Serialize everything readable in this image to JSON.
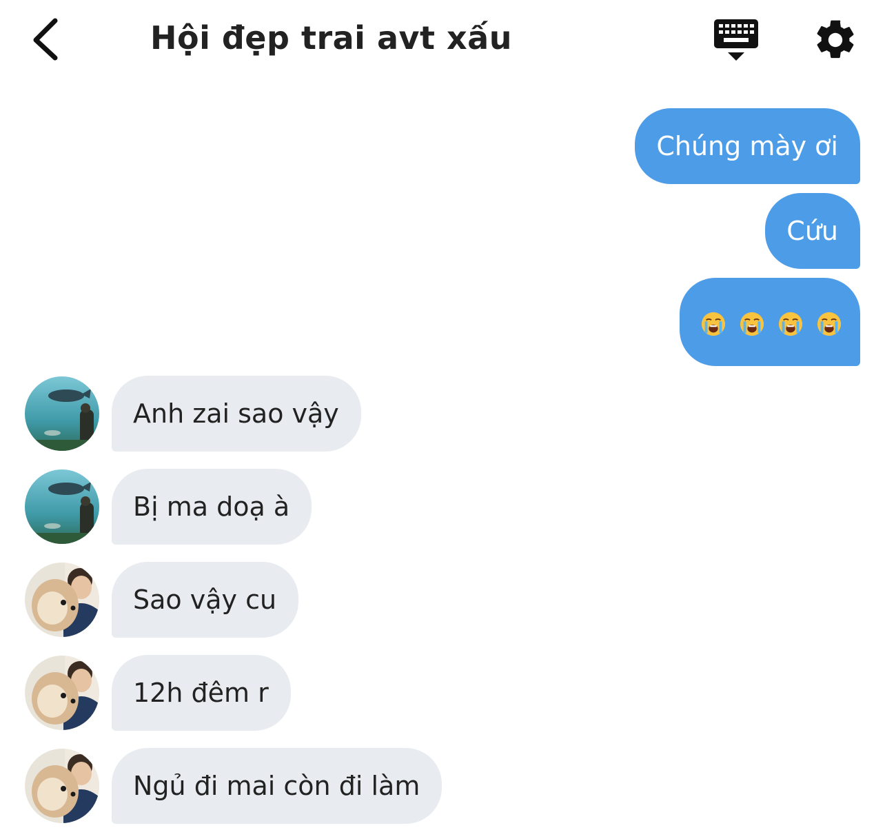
{
  "header": {
    "title": "Hội đẹp trai avt xấu",
    "back_icon": "chevron-left-icon",
    "keyboard_icon": "keyboard-icon",
    "settings_icon": "gear-icon"
  },
  "colors": {
    "outgoing_bubble": "#4c9ce8",
    "incoming_bubble": "#e8ecf0",
    "text_dark": "#222222"
  },
  "messages": [
    {
      "direction": "outgoing",
      "text": "Chúng mày ơi"
    },
    {
      "direction": "outgoing",
      "text": "Cứu"
    },
    {
      "direction": "outgoing",
      "text": "😭😭😭😭",
      "emoji": "loudly-crying-face",
      "count": 4
    },
    {
      "direction": "incoming",
      "sender_avatar": "aquarium-avatar",
      "text": "Anh zai sao vậy"
    },
    {
      "direction": "incoming",
      "sender_avatar": "aquarium-avatar",
      "text": "Bị ma doạ à"
    },
    {
      "direction": "incoming",
      "sender_avatar": "dog-selfie-avatar",
      "text": "Sao vậy cu"
    },
    {
      "direction": "incoming",
      "sender_avatar": "dog-selfie-avatar",
      "text": "12h đêm r"
    },
    {
      "direction": "incoming",
      "sender_avatar": "dog-selfie-avatar",
      "text": "Ngủ đi mai còn đi làm"
    }
  ]
}
